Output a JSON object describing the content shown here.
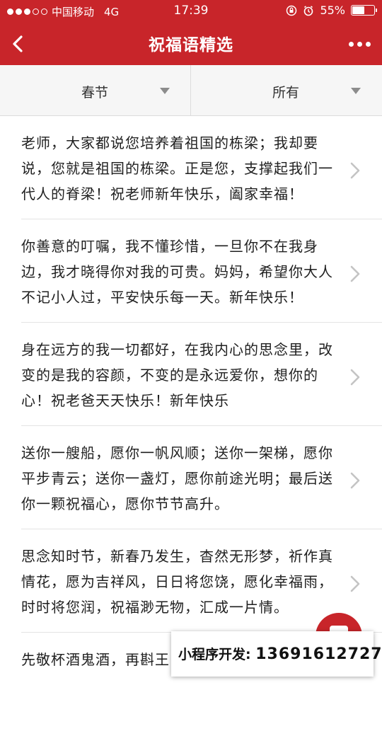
{
  "status_bar": {
    "carrier": "中国移动",
    "network": "4G",
    "time": "17:39",
    "battery": "55%"
  },
  "nav": {
    "title": "祝福语精选",
    "back_icon": "chevron-left-icon",
    "more_icon": "more-dots-icon"
  },
  "filters": [
    {
      "label": "春节"
    },
    {
      "label": "所有"
    }
  ],
  "items": [
    {
      "text": "老师，大家都说您培养着祖国的栋梁；我却要说，您就是祖国的栋梁。正是您，支撑起我们一代人的脊梁！祝老师新年快乐，阖家幸福！"
    },
    {
      "text": "你善意的叮嘱，我不懂珍惜，一旦你不在我身边，我才晓得你对我的可贵。妈妈，希望你大人不记小人过，平安快乐每一天。新年快乐！"
    },
    {
      "text": "身在远方的我一切都好，在我内心的思念里，改变的是我的容颜，不变的是永远爱你，想你的心！祝老爸天天快乐！新年快乐"
    },
    {
      "text": "送你一艘船，愿你一帆风顺；送你一架梯，愿你平步青云；送你一盏灯，愿你前途光明；最后送你一颗祝福心，愿你节节高升。"
    },
    {
      "text": "思念知时节，新春乃发生，杳然无形梦，祈作真情花，愿为吉祥风，日日将您饶，愿化幸福雨，时时将您润，祝福渺无物，汇成一片情。"
    },
    {
      "text": "先敬杯酒鬼酒，再斟王"
    }
  ],
  "promo": {
    "label": "小程序开发:",
    "phone": "13691612727"
  },
  "colors": {
    "brand_red": "#c8252a"
  }
}
